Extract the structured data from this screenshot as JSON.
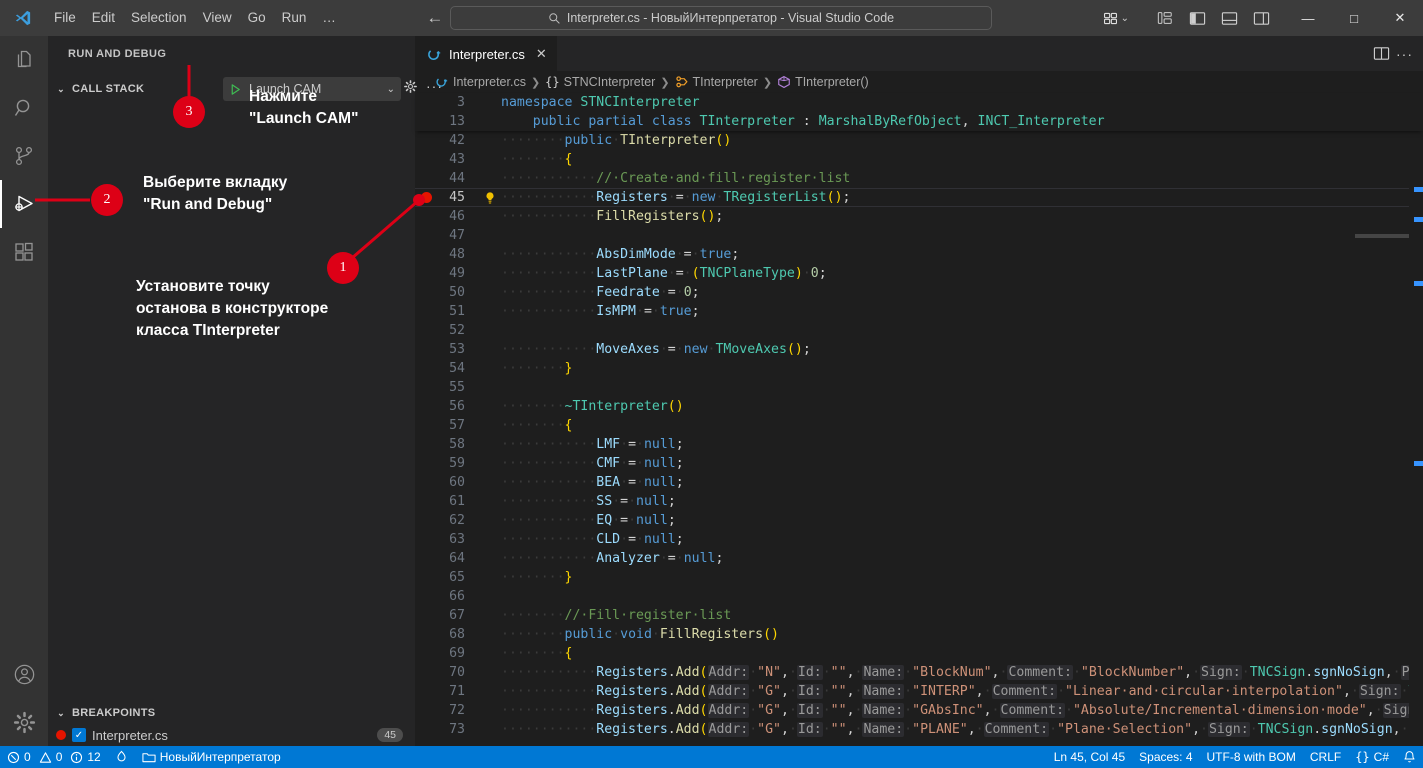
{
  "titlebar": {
    "logo": "vscode-logo",
    "menu": [
      "File",
      "Edit",
      "Selection",
      "View",
      "Go",
      "Run",
      "…"
    ],
    "nav_back": "←",
    "nav_forward": "→",
    "quick_input_value": "Interpreter.cs - НовыйИнтерпретатор - Visual Studio Code",
    "window_minimize": "—",
    "window_maximize": "□",
    "window_close": "✕"
  },
  "activitybar": {
    "items": [
      {
        "name": "explorer",
        "icon": "files-icon"
      },
      {
        "name": "search",
        "icon": "search-icon"
      },
      {
        "name": "source-control",
        "icon": "source-control-icon"
      },
      {
        "name": "run-and-debug",
        "icon": "run-and-debug-icon",
        "active": true
      },
      {
        "name": "extensions",
        "icon": "extensions-icon"
      }
    ],
    "bottom": [
      {
        "name": "accounts",
        "icon": "account-icon"
      },
      {
        "name": "manage",
        "icon": "gear-icon"
      }
    ]
  },
  "sidebar": {
    "title": "RUN AND DEBUG",
    "launch_config": "Launch CAM",
    "launch_start_icon": "play-icon",
    "launch_chevron": "⌄",
    "gear_icon": "gear-icon",
    "more_icon": "more-icon",
    "callstack_label": "CALL STACK",
    "breakpoints_label": "BREAKPOINTS",
    "breakpoint": {
      "file": "Interpreter.cs",
      "line": "45",
      "checked": true
    }
  },
  "annotations": [
    {
      "number": "1",
      "text": "Установите точку\nостанова в конструкторе\nкласса TInterpreter"
    },
    {
      "number": "2",
      "text": "Выберите вкладку\n\"Run and Debug\""
    },
    {
      "number": "3",
      "text": "Нажмите\n\"Launch CAM\""
    }
  ],
  "editor": {
    "tab": {
      "label": "Interpreter.cs",
      "icon": "csharp-icon",
      "close": "✕"
    },
    "tab_actions": {
      "split_icon": "split-editor-icon",
      "more_icon": "more-icon"
    },
    "breadcrumbs": [
      {
        "label": "Interpreter.cs",
        "icon": "csharp-icon"
      },
      {
        "label": "STNCInterpreter",
        "icon": "namespace-icon"
      },
      {
        "label": "TInterpreter",
        "icon": "class-icon"
      },
      {
        "label": "TInterpreter()",
        "icon": "method-icon"
      }
    ],
    "sticky_lines": [
      {
        "num": "3",
        "html": "<span class=\"t-kw\">namespace</span> <span class=\"t-type\">STNCInterpreter</span>"
      },
      {
        "num": "13",
        "html": "&nbsp;&nbsp;&nbsp;&nbsp;<span class=\"t-kw\">public</span> <span class=\"t-kw\">partial</span> <span class=\"t-kw\">class</span> <span class=\"t-type\">TInterpreter</span> <span class=\"t-pun\">:</span> <span class=\"t-type\">MarshalByRefObject</span><span class=\"t-pun\">,</span> <span class=\"t-type\">INCT_Interpreter</span>"
      }
    ],
    "lines": [
      {
        "num": "42",
        "html": "<span class=\"ws\">····</span><span class=\"ws\">····</span><span class=\"t-kw\">public</span><span class=\"ws\">·</span><span class=\"t-fn\">TInterpreter</span><span class=\"t-br1\">()</span>"
      },
      {
        "num": "43",
        "html": "<span class=\"ws\">····</span><span class=\"ws\">····</span><span class=\"t-br1\">{</span>"
      },
      {
        "num": "44",
        "html": "<span class=\"ws\">····</span><span class=\"ws\">····</span><span class=\"ws\">····</span><span class=\"t-cmt\">//·Create·and·fill·register·list</span>"
      },
      {
        "num": "45",
        "html": "<span class=\"ws\">····</span><span class=\"ws\">····</span><span class=\"ws\">····</span><span class=\"t-var\">Registers</span><span class=\"ws\">·</span><span class=\"t-pun\">=</span><span class=\"ws\">·</span><span class=\"t-kw\">new</span><span class=\"ws\">·</span><span class=\"t-type\">TRegisterList</span><span class=\"t-br1\">()</span><span class=\"t-pun\">;</span>",
        "active": true,
        "breakpoint": true,
        "lightbulb": true
      },
      {
        "num": "46",
        "html": "<span class=\"ws\">····</span><span class=\"ws\">····</span><span class=\"ws\">····</span><span class=\"t-fn\">FillRegisters</span><span class=\"t-br1\">()</span><span class=\"t-pun\">;</span>"
      },
      {
        "num": "47",
        "html": ""
      },
      {
        "num": "48",
        "html": "<span class=\"ws\">····</span><span class=\"ws\">····</span><span class=\"ws\">····</span><span class=\"t-var\">AbsDimMode</span><span class=\"ws\">·</span><span class=\"t-pun\">=</span><span class=\"ws\">·</span><span class=\"t-kw\">true</span><span class=\"t-pun\">;</span>"
      },
      {
        "num": "49",
        "html": "<span class=\"ws\">····</span><span class=\"ws\">····</span><span class=\"ws\">····</span><span class=\"t-var\">LastPlane</span><span class=\"ws\">·</span><span class=\"t-pun\">=</span><span class=\"ws\">·</span><span class=\"t-br1\">(</span><span class=\"t-type\">TNCPlaneType</span><span class=\"t-br1\">)</span><span class=\"ws\">·</span><span class=\"t-num\">0</span><span class=\"t-pun\">;</span>"
      },
      {
        "num": "50",
        "html": "<span class=\"ws\">····</span><span class=\"ws\">····</span><span class=\"ws\">····</span><span class=\"t-var\">Feedrate</span><span class=\"ws\">·</span><span class=\"t-pun\">=</span><span class=\"ws\">·</span><span class=\"t-num\">0</span><span class=\"t-pun\">;</span>"
      },
      {
        "num": "51",
        "html": "<span class=\"ws\">····</span><span class=\"ws\">····</span><span class=\"ws\">····</span><span class=\"t-var\">IsMPM</span><span class=\"ws\">·</span><span class=\"t-pun\">=</span><span class=\"ws\">·</span><span class=\"t-kw\">true</span><span class=\"t-pun\">;</span>"
      },
      {
        "num": "52",
        "html": ""
      },
      {
        "num": "53",
        "html": "<span class=\"ws\">····</span><span class=\"ws\">····</span><span class=\"ws\">····</span><span class=\"t-var\">MoveAxes</span><span class=\"ws\">·</span><span class=\"t-pun\">=</span><span class=\"ws\">·</span><span class=\"t-kw\">new</span><span class=\"ws\">·</span><span class=\"t-type\">TMoveAxes</span><span class=\"t-br1\">()</span><span class=\"t-pun\">;</span>"
      },
      {
        "num": "54",
        "html": "<span class=\"ws\">····</span><span class=\"ws\">····</span><span class=\"t-br1\">}</span>"
      },
      {
        "num": "55",
        "html": ""
      },
      {
        "num": "56",
        "html": "<span class=\"ws\">····</span><span class=\"ws\">····</span><span class=\"t-type\">~TInterpreter</span><span class=\"t-br1\">()</span>"
      },
      {
        "num": "57",
        "html": "<span class=\"ws\">····</span><span class=\"ws\">····</span><span class=\"t-br1\">{</span>"
      },
      {
        "num": "58",
        "html": "<span class=\"ws\">····</span><span class=\"ws\">····</span><span class=\"ws\">····</span><span class=\"t-var\">LMF</span><span class=\"ws\">·</span><span class=\"t-pun\">=</span><span class=\"ws\">·</span><span class=\"t-kw\">null</span><span class=\"t-pun\">;</span>"
      },
      {
        "num": "59",
        "html": "<span class=\"ws\">····</span><span class=\"ws\">····</span><span class=\"ws\">····</span><span class=\"t-var\">CMF</span><span class=\"ws\">·</span><span class=\"t-pun\">=</span><span class=\"ws\">·</span><span class=\"t-kw\">null</span><span class=\"t-pun\">;</span>"
      },
      {
        "num": "60",
        "html": "<span class=\"ws\">····</span><span class=\"ws\">····</span><span class=\"ws\">····</span><span class=\"t-var\">BEA</span><span class=\"ws\">·</span><span class=\"t-pun\">=</span><span class=\"ws\">·</span><span class=\"t-kw\">null</span><span class=\"t-pun\">;</span>"
      },
      {
        "num": "61",
        "html": "<span class=\"ws\">····</span><span class=\"ws\">····</span><span class=\"ws\">····</span><span class=\"t-var\">SS</span><span class=\"ws\">·</span><span class=\"t-pun\">=</span><span class=\"ws\">·</span><span class=\"t-kw\">null</span><span class=\"t-pun\">;</span>"
      },
      {
        "num": "62",
        "html": "<span class=\"ws\">····</span><span class=\"ws\">····</span><span class=\"ws\">····</span><span class=\"t-var\">EQ</span><span class=\"ws\">·</span><span class=\"t-pun\">=</span><span class=\"ws\">·</span><span class=\"t-kw\">null</span><span class=\"t-pun\">;</span>"
      },
      {
        "num": "63",
        "html": "<span class=\"ws\">····</span><span class=\"ws\">····</span><span class=\"ws\">····</span><span class=\"t-var\">CLD</span><span class=\"ws\">·</span><span class=\"t-pun\">=</span><span class=\"ws\">·</span><span class=\"t-kw\">null</span><span class=\"t-pun\">;</span>"
      },
      {
        "num": "64",
        "html": "<span class=\"ws\">····</span><span class=\"ws\">····</span><span class=\"ws\">····</span><span class=\"t-var\">Analyzer</span><span class=\"ws\">·</span><span class=\"t-pun\">=</span><span class=\"ws\">·</span><span class=\"t-kw\">null</span><span class=\"t-pun\">;</span>"
      },
      {
        "num": "65",
        "html": "<span class=\"ws\">····</span><span class=\"ws\">····</span><span class=\"t-br1\">}</span>"
      },
      {
        "num": "66",
        "html": ""
      },
      {
        "num": "67",
        "html": "<span class=\"ws\">····</span><span class=\"ws\">····</span><span class=\"t-cmt\">//·Fill·register·list</span>"
      },
      {
        "num": "68",
        "html": "<span class=\"ws\">····</span><span class=\"ws\">····</span><span class=\"t-kw\">public</span><span class=\"ws\">·</span><span class=\"t-kw\">void</span><span class=\"ws\">·</span><span class=\"t-fn\">FillRegisters</span><span class=\"t-br1\">()</span>"
      },
      {
        "num": "69",
        "html": "<span class=\"ws\">····</span><span class=\"ws\">····</span><span class=\"t-br1\">{</span>"
      },
      {
        "num": "70",
        "html": "<span class=\"ws\">····</span><span class=\"ws\">····</span><span class=\"ws\">····</span><span class=\"t-var\">Registers</span><span class=\"t-pun\">.</span><span class=\"t-fn\">Add</span><span class=\"t-br1\">(</span><span class=\"t-hint\">Addr:</span><span class=\"ws\">·</span><span class=\"t-str\">\"N\"</span><span class=\"t-pun\">,</span><span class=\"ws\">·</span><span class=\"t-hint\">Id:</span><span class=\"ws\">·</span><span class=\"t-str\">\"\"</span><span class=\"t-pun\">,</span><span class=\"ws\">·</span><span class=\"t-hint\">Name:</span><span class=\"ws\">·</span><span class=\"t-str\">\"BlockNum\"</span><span class=\"t-pun\">,</span><span class=\"ws\">·</span><span class=\"t-hint\">Comment:</span><span class=\"ws\">·</span><span class=\"t-str\">\"BlockNumber\"</span><span class=\"t-pun\">,</span><span class=\"ws\">·</span><span class=\"t-hint\">Sign:</span><span class=\"ws\">·</span><span class=\"t-type\">TNCSign</span><span class=\"t-pun\">.</span><span class=\"t-var\">sgnNoSign</span><span class=\"t-pun\">,</span><span class=\"ws\">·</span><span class=\"t-hint\">Point:</span><span class=\"ws\">·</span><span class=\"t-type\">TNC</span>"
      },
      {
        "num": "71",
        "html": "<span class=\"ws\">····</span><span class=\"ws\">····</span><span class=\"ws\">····</span><span class=\"t-var\">Registers</span><span class=\"t-pun\">.</span><span class=\"t-fn\">Add</span><span class=\"t-br1\">(</span><span class=\"t-hint\">Addr:</span><span class=\"ws\">·</span><span class=\"t-str\">\"G\"</span><span class=\"t-pun\">,</span><span class=\"ws\">·</span><span class=\"t-hint\">Id:</span><span class=\"ws\">·</span><span class=\"t-str\">\"\"</span><span class=\"t-pun\">,</span><span class=\"ws\">·</span><span class=\"t-hint\">Name:</span><span class=\"ws\">·</span><span class=\"t-str\">\"INTERP\"</span><span class=\"t-pun\">,</span><span class=\"ws\">·</span><span class=\"t-hint\">Comment:</span><span class=\"ws\">·</span><span class=\"t-str\">\"Linear·and·circular·interpolation\"</span><span class=\"t-pun\">,</span><span class=\"ws\">·</span><span class=\"t-hint\">Sign:</span><span class=\"ws\">·</span><span class=\"t-type\">TNCSign</span><span class=\"t-pun\">.</span><span class=\"t-var\">sg</span>"
      },
      {
        "num": "72",
        "html": "<span class=\"ws\">····</span><span class=\"ws\">····</span><span class=\"ws\">····</span><span class=\"t-var\">Registers</span><span class=\"t-pun\">.</span><span class=\"t-fn\">Add</span><span class=\"t-br1\">(</span><span class=\"t-hint\">Addr:</span><span class=\"ws\">·</span><span class=\"t-str\">\"G\"</span><span class=\"t-pun\">,</span><span class=\"ws\">·</span><span class=\"t-hint\">Id:</span><span class=\"ws\">·</span><span class=\"t-str\">\"\"</span><span class=\"t-pun\">,</span><span class=\"ws\">·</span><span class=\"t-hint\">Name:</span><span class=\"ws\">·</span><span class=\"t-str\">\"GAbsInc\"</span><span class=\"t-pun\">,</span><span class=\"ws\">·</span><span class=\"t-hint\">Comment:</span><span class=\"ws\">·</span><span class=\"t-str\">\"Absolute/Incremental·dimension·mode\"</span><span class=\"t-pun\">,</span><span class=\"ws\">·</span><span class=\"t-hint\">Sign:</span><span class=\"ws\">·</span><span class=\"t-type\">TNCSign</span>"
      },
      {
        "num": "73",
        "html": "<span class=\"ws\">····</span><span class=\"ws\">····</span><span class=\"ws\">····</span><span class=\"t-var\">Registers</span><span class=\"t-pun\">.</span><span class=\"t-fn\">Add</span><span class=\"t-br1\">(</span><span class=\"t-hint\">Addr:</span><span class=\"ws\">·</span><span class=\"t-str\">\"G\"</span><span class=\"t-pun\">,</span><span class=\"ws\">·</span><span class=\"t-hint\">Id:</span><span class=\"ws\">·</span><span class=\"t-str\">\"\"</span><span class=\"t-pun\">,</span><span class=\"ws\">·</span><span class=\"t-hint\">Name:</span><span class=\"ws\">·</span><span class=\"t-str\">\"PLANE\"</span><span class=\"t-pun\">,</span><span class=\"ws\">·</span><span class=\"t-hint\">Comment:</span><span class=\"ws\">·</span><span class=\"t-str\">\"Plane·Selection\"</span><span class=\"t-pun\">,</span><span class=\"ws\">·</span><span class=\"t-hint\">Sign:</span><span class=\"ws\">·</span><span class=\"t-type\">TNCSign</span><span class=\"t-pun\">.</span><span class=\"t-var\">sgnNoSign</span><span class=\"t-pun\">,</span><span class=\"ws\">·</span><span class=\"t-hint\">Point:</span><span class=\"ws\">·</span><span class=\"t-type\">TN</span>"
      }
    ]
  },
  "statusbar": {
    "errors": "0",
    "warnings": "0",
    "infos": "12",
    "port_icon": "ports-icon",
    "folder": "НовыйИнтерпретатор",
    "cursor": "Ln 45, Col 45",
    "indent": "Spaces: 4",
    "encoding": "UTF-8 with BOM",
    "eol": "CRLF",
    "language": "C#",
    "lang_icon": "{}",
    "bell": "bell-icon"
  },
  "colors": {
    "accent": "#0078d4",
    "marker_red": "#dd0016",
    "breakpoint_red": "#e51400",
    "titlebar_bg": "#3c3c3c",
    "sidebar_bg": "#252526",
    "editor_bg": "#1e1e1e"
  }
}
